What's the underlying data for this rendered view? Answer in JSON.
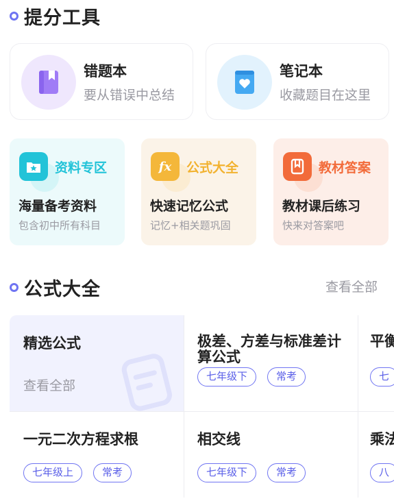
{
  "sections": {
    "tools_title": "提分工具",
    "formula_title": "公式大全",
    "see_all": "查看全部"
  },
  "big_cards": [
    {
      "title": "错题本",
      "subtitle": "要从错误中总结",
      "icon": "book-icon",
      "color": "#9b7bf5",
      "bg": "#efe7fd"
    },
    {
      "title": "笔记本",
      "subtitle": "收藏题目在这里",
      "icon": "heart-notebook-icon",
      "color": "#3fa2f0",
      "bg": "#e2f2fd"
    }
  ],
  "tool_cards": [
    {
      "name": "资料专区",
      "main": "海量备考资料",
      "sub": "包含初中所有科目",
      "icon": "folder-star-icon",
      "color": "#22c3d8",
      "bg": "#ecfafb"
    },
    {
      "name": "公式大全",
      "main": "快速记忆公式",
      "sub": "记忆+相关题巩固",
      "icon": "fx-icon",
      "color": "#f2b230",
      "bg": "#fbf3e8"
    },
    {
      "name": "教材答案",
      "main": "教材课后练习",
      "sub": "快来对答案吧",
      "icon": "bookmark-icon",
      "color": "#f26b3a",
      "bg": "#fdeee8"
    }
  ],
  "featured": {
    "title": "精选公式",
    "see_all": "查看全部"
  },
  "formulas": [
    {
      "title_line1": "极差、方差与标准差计",
      "title_line2": "算公式",
      "tags": [
        "七年级下",
        "常考"
      ]
    },
    {
      "title": "平衡",
      "tags": [
        "七"
      ]
    },
    {
      "title": "一元二次方程求根",
      "tags": [
        "七年级上",
        "常考"
      ]
    },
    {
      "title": "相交线",
      "tags": [
        "七年级下",
        "常考"
      ]
    },
    {
      "title": "乘法",
      "tags": [
        "八"
      ]
    }
  ]
}
